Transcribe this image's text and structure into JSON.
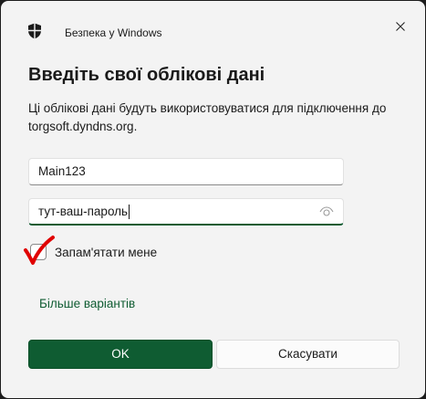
{
  "window": {
    "title": "Безпека у Windows",
    "close_icon": "close-icon",
    "app_icon": "shield-icon"
  },
  "dialog": {
    "heading": "Введіть свої облікові дані",
    "description": "Ці облікові дані будуть використовуватися для підключення до torgsoft.dyndns.org."
  },
  "username": {
    "value": "Main123"
  },
  "password": {
    "value": "тут-ваш-пароль",
    "reveal_icon": "eye-icon"
  },
  "remember": {
    "label": "Запам'ятати мене",
    "checkmark_color": "#e00000"
  },
  "more_choices": {
    "label": "Більше варіантів"
  },
  "buttons": {
    "ok_label": "OK",
    "cancel_label": "Скасувати"
  },
  "colors": {
    "accent": "#0f5c32",
    "background": "#f3f3f3",
    "outer": "#1c1c1c"
  }
}
